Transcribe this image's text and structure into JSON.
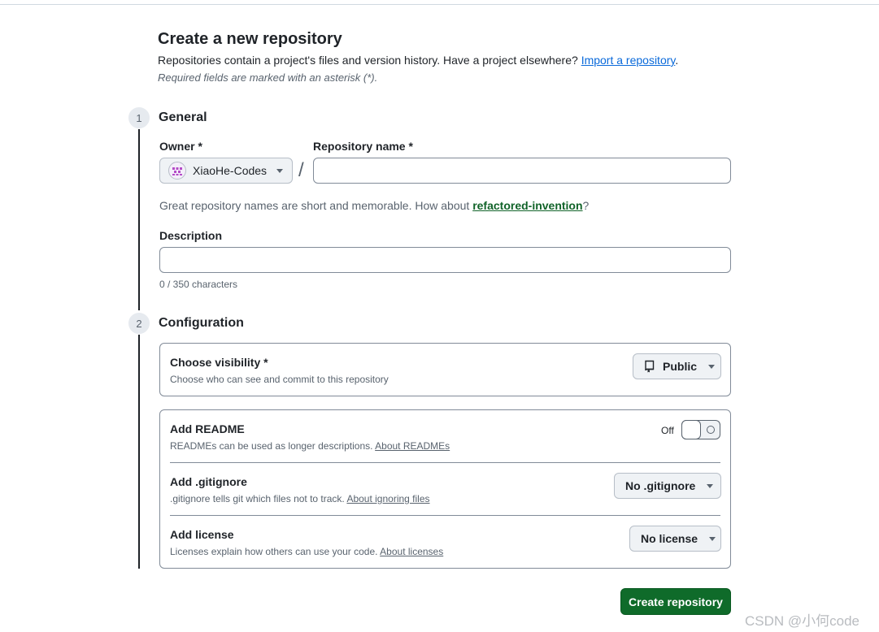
{
  "page": {
    "title": "Create a new repository",
    "subtitle": "Repositories contain a project's files and version history. Have a project elsewhere?",
    "import_link": "Import a repository",
    "subtitle_end": ".",
    "required_note": "Required fields are marked with an asterisk (*)."
  },
  "general": {
    "step_number": "1",
    "title": "General",
    "owner_label": "Owner *",
    "owner_value": "XiaoHe-Codes",
    "separator": "/",
    "repo_name_label": "Repository name *",
    "repo_name_value": "",
    "hint_prefix": "Great repository names are short and memorable. How about",
    "suggested_name": "refactored-invention",
    "hint_suffix": "?",
    "description_label": "Description",
    "description_value": "",
    "char_counter": "0 / 350 characters"
  },
  "configuration": {
    "step_number": "2",
    "title": "Configuration",
    "visibility": {
      "title": "Choose visibility *",
      "desc": "Choose who can see and commit to this repository",
      "value": "Public"
    },
    "readme": {
      "title": "Add README",
      "desc": "READMEs can be used as longer descriptions.",
      "link": "About READMEs",
      "toggle_state_label": "Off"
    },
    "gitignore": {
      "title": "Add .gitignore",
      "desc": ".gitignore tells git which files not to track.",
      "link": "About ignoring files",
      "value": "No .gitignore"
    },
    "license": {
      "title": "Add license",
      "desc": "Licenses explain how others can use your code.",
      "link": "About licenses",
      "value": "No license"
    }
  },
  "actions": {
    "create_label": "Create repository"
  },
  "watermark": "CSDN @小何code",
  "colors": {
    "primary_button": "#0f6b2a",
    "link": "#0969da",
    "suggestion_link": "#116329"
  }
}
